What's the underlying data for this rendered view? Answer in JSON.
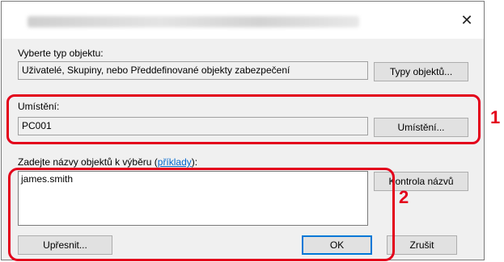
{
  "dialog": {
    "close_glyph": "✕"
  },
  "object_type": {
    "label": "Vyberte typ objektu:",
    "value": "Uživatelé, Skupiny, nebo Předdefinované objekty zabezpečení",
    "button": "Typy objektů..."
  },
  "location": {
    "label": "Umístění:",
    "value": "PC001",
    "button": "Umístění..."
  },
  "names": {
    "label_prefix": "Zadejte názvy objektů k výběru (",
    "link": "příklady",
    "label_suffix": "):",
    "value": "james.smith",
    "check_button": "Kontrola názvů"
  },
  "footer": {
    "advanced_button": "Upřesnit...",
    "ok_button": "OK",
    "cancel_button": "Zrušit"
  },
  "callouts": {
    "one": "1",
    "two": "2",
    "color": "#e3001b"
  }
}
